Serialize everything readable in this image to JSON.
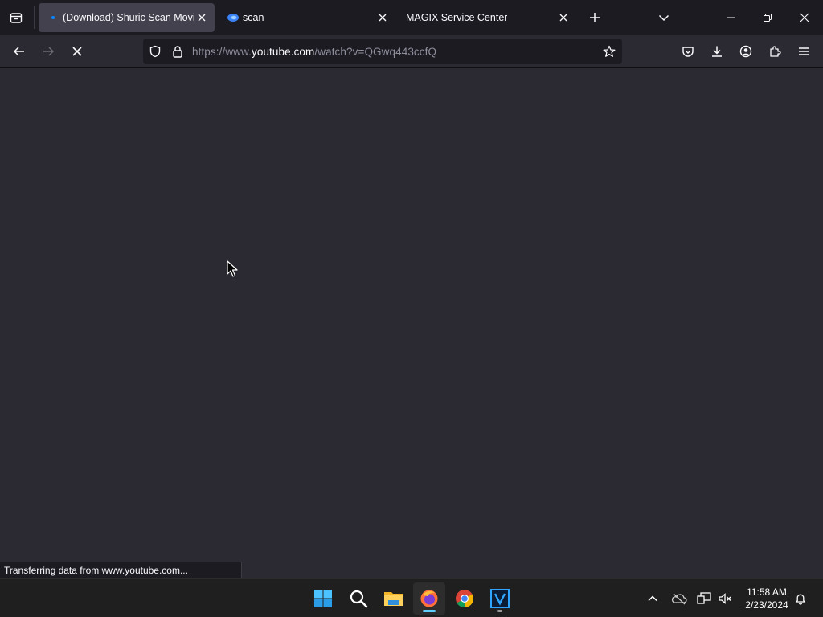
{
  "browser": {
    "tabs": [
      {
        "title": "(Download) Shuric Scan Movie",
        "active": true,
        "favicon": "loading-dot-icon"
      },
      {
        "title": "scan",
        "active": false,
        "favicon": "edge-style-blue-icon"
      },
      {
        "title": "MAGIX Service Center",
        "active": false,
        "favicon": ""
      }
    ],
    "url": {
      "prefix": "https://www.",
      "host": "youtube.com",
      "path": "/watch?v=QGwq443ccfQ"
    },
    "status_text": "Transferring data from www.youtube.com..."
  },
  "taskbar": {
    "apps": [
      "windows-start-icon",
      "search-icon",
      "file-explorer-icon",
      "firefox-icon",
      "chrome-icon",
      "vegas-icon"
    ],
    "clock": {
      "time": "11:58 AM",
      "date": "2/23/2024"
    }
  },
  "colors": {
    "tabbar_bg": "#1c1b22",
    "toolbar_bg": "#2b2a33",
    "content_bg": "#2b2a33",
    "active_tab_bg": "#42414d",
    "taskbar_bg": "#1f1f1f",
    "accent": "#0078d4"
  }
}
